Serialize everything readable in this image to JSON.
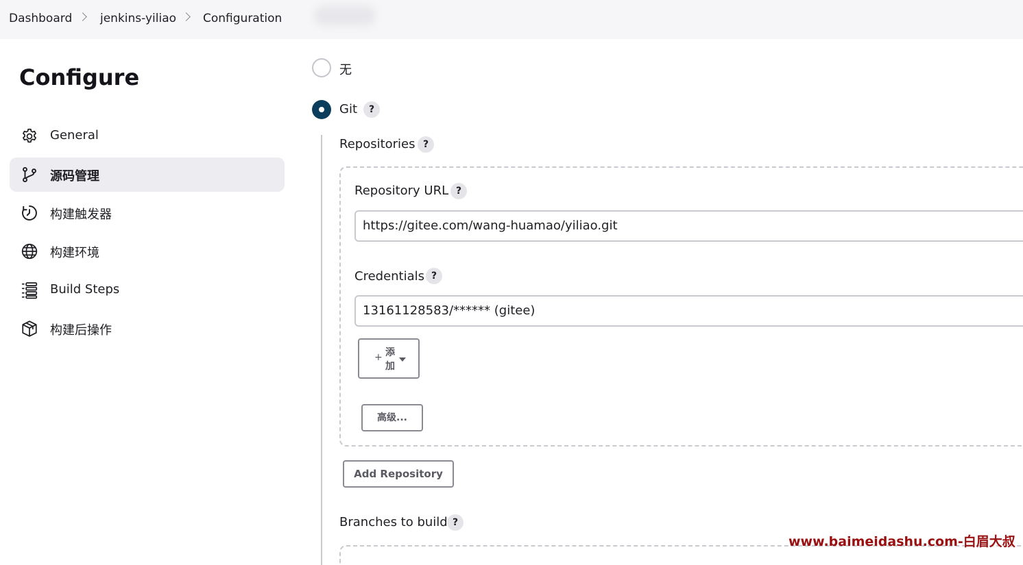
{
  "breadcrumb": {
    "items": [
      "Dashboard",
      "jenkins-yiliao",
      "Configuration"
    ]
  },
  "sidebar": {
    "title": "Configure",
    "items": [
      {
        "label": "General",
        "icon": "gear-icon"
      },
      {
        "label": "源码管理",
        "icon": "branch-icon",
        "active": true
      },
      {
        "label": "构建触发器",
        "icon": "clock-icon"
      },
      {
        "label": "构建环境",
        "icon": "globe-icon"
      },
      {
        "label": "Build Steps",
        "icon": "list-icon"
      },
      {
        "label": "构建后操作",
        "icon": "package-icon"
      }
    ]
  },
  "scm": {
    "options": [
      {
        "label": "无",
        "selected": false
      },
      {
        "label": "Git",
        "selected": true
      }
    ],
    "help_symbol": "?",
    "repositories_label": "Repositories",
    "repository_url_label": "Repository URL",
    "repository_url_value": "https://gitee.com/wang-huamao/yiliao.git",
    "credentials_label": "Credentials",
    "credentials_value": "13161128583/****** (gitee)",
    "add_button_plus": "+",
    "add_button_label": "添加",
    "advanced_button_label": "高级...",
    "add_repository_label": "Add Repository",
    "branches_label": "Branches to build"
  },
  "watermark": "www.baimeidashu.com-白眉大叔",
  "colors": {
    "accent": "#0b3d5c",
    "watermark": "#9a0f0f",
    "topbar_bg": "#f6f6f8",
    "active_item_bg": "#ededf1"
  }
}
